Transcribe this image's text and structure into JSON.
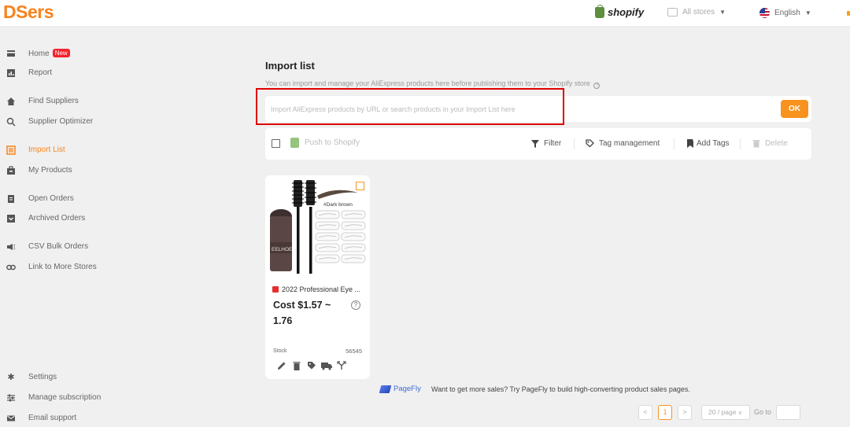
{
  "header": {
    "logo": "DSers",
    "shopify_label": "shopify",
    "store_selector": "All stores",
    "language": "English"
  },
  "sidebar": {
    "items": [
      {
        "label": "Home",
        "badge": "New",
        "icon": "home-icon"
      },
      {
        "label": "Report",
        "icon": "report-icon"
      },
      {
        "label": "Find Suppliers",
        "icon": "find-suppliers-icon"
      },
      {
        "label": "Supplier Optimizer",
        "icon": "search-icon"
      },
      {
        "label": "Import List",
        "icon": "import-list-icon",
        "active": true
      },
      {
        "label": "My Products",
        "icon": "my-products-icon"
      },
      {
        "label": "Open Orders",
        "icon": "open-orders-icon"
      },
      {
        "label": "Archived Orders",
        "icon": "archived-orders-icon"
      },
      {
        "label": "CSV Bulk Orders",
        "icon": "megaphone-icon"
      },
      {
        "label": "Link to More Stores",
        "icon": "link-icon"
      },
      {
        "label": "Settings",
        "icon": "gear-icon"
      },
      {
        "label": "Manage subscription",
        "icon": "sliders-icon"
      },
      {
        "label": "Email support",
        "icon": "email-icon"
      }
    ]
  },
  "main": {
    "title": "Import list",
    "subtitle": "You can import and manage your AliExpress products here before publishing them to your Shopify store",
    "search": {
      "placeholder": "Import AliExpress products by URL or search products in your Import List here",
      "value": "",
      "ok_label": "OK"
    },
    "toolbar": {
      "push_label": "Push to Shopify",
      "filter_label": "Filter",
      "tag_management_label": "Tag management",
      "add_tags_label": "Add Tags",
      "delete_label": "Delete"
    },
    "product": {
      "name": "2022 Professional Eye ...",
      "cost": "Cost $1.57 ~ 1.76",
      "stock_label": "Stock",
      "stock_value": "56545",
      "image_tag": "#Dark brown",
      "image_brand": "EELHOE"
    },
    "promo": {
      "brand": "PageFly",
      "text": "Want to get more sales? Try PageFly to build high-converting product sales pages."
    },
    "pagination": {
      "prev": "<",
      "current_page": "1",
      "next": ">",
      "page_size": "20 / page",
      "goto_label": "Go to"
    }
  },
  "colors": {
    "accent": "#f7931e",
    "highlight_box": "#e00000",
    "shopify_green": "#5e8e3e"
  }
}
